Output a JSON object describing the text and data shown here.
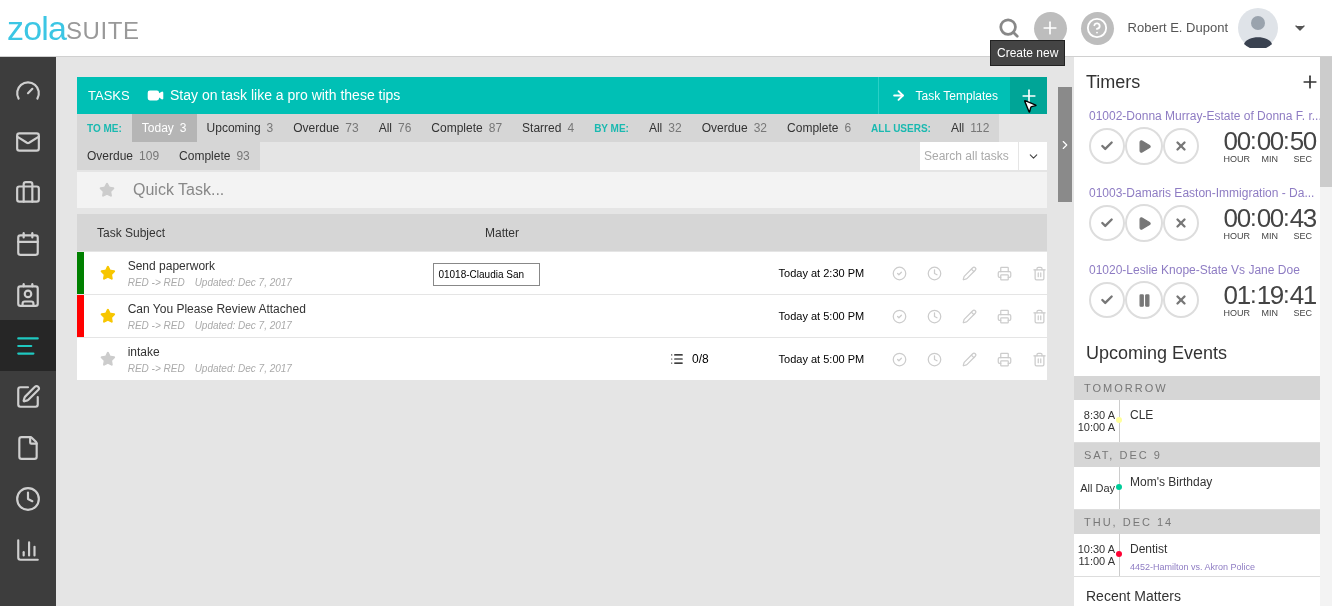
{
  "header": {
    "logo_primary": "zola",
    "logo_secondary": "SUITE",
    "user_name": "Robert E. Dupont",
    "tooltip": "Create new"
  },
  "sidebar": [
    {
      "kind": "dashboard",
      "selected": false
    },
    {
      "kind": "mail",
      "selected": false
    },
    {
      "kind": "briefcase",
      "selected": false
    },
    {
      "kind": "calendar",
      "selected": false
    },
    {
      "kind": "contacts",
      "selected": false
    },
    {
      "kind": "tasks",
      "selected": true
    },
    {
      "kind": "notes",
      "selected": false
    },
    {
      "kind": "document",
      "selected": false
    },
    {
      "kind": "clock",
      "selected": false
    },
    {
      "kind": "chart",
      "selected": false
    }
  ],
  "tasks_bar": {
    "title": "TASKS",
    "tip": "Stay on task like a pro with these tips",
    "templates": "Task Templates"
  },
  "filters": [
    {
      "label": "TO ME:",
      "items": [
        {
          "label": "Today",
          "count": "3",
          "selected": true
        },
        {
          "label": "Upcoming",
          "count": "3",
          "selected": false
        },
        {
          "label": "Overdue",
          "count": "73",
          "selected": false
        },
        {
          "label": "All",
          "count": "76",
          "selected": false
        },
        {
          "label": "Complete",
          "count": "87",
          "selected": false
        },
        {
          "label": "Starred",
          "count": "4",
          "selected": false
        }
      ]
    },
    {
      "label": "BY ME:",
      "items": [
        {
          "label": "All",
          "count": "32",
          "selected": false
        },
        {
          "label": "Overdue",
          "count": "32",
          "selected": false
        },
        {
          "label": "Complete",
          "count": "6",
          "selected": false
        }
      ]
    },
    {
      "label": "ALL USERS:",
      "items": [
        {
          "label": "All",
          "count": "112",
          "selected": false
        },
        {
          "label": "Overdue",
          "count": "109",
          "selected": false
        },
        {
          "label": "Complete",
          "count": "93",
          "selected": false
        }
      ]
    }
  ],
  "search": {
    "placeholder": "Search all tasks"
  },
  "quick_task": {
    "placeholder": "Quick Task..."
  },
  "table": {
    "columns": [
      "Task Subject",
      "Matter"
    ],
    "rows": [
      {
        "color": "#008000",
        "starred": true,
        "subject": "Send paperwork",
        "status": "RED -> RED",
        "updated": "Updated: Dec 7, 2017",
        "matter": "01018-Claudia San",
        "due": "Today at 2:30 PM"
      },
      {
        "color": "#ff0000",
        "starred": true,
        "subject": "Can You Please Review Attached",
        "status": "RED -> RED",
        "updated": "Updated: Dec 7, 2017",
        "due": "Today at 5:00 PM"
      },
      {
        "starred": false,
        "subject": "intake",
        "status": "RED -> RED",
        "updated": "Updated: Dec 7, 2017",
        "checklist": "0/8",
        "due": "Today at 5:00 PM"
      }
    ]
  },
  "timers": {
    "title": "Timers",
    "items": [
      {
        "matter": "01002-Donna Murray-Estate of Donna F. r...",
        "running": false,
        "hours": "00",
        "minutes": "00",
        "seconds": "50",
        "separators": [
          ":",
          ":"
        ],
        "units": [
          "HOUR",
          "MIN",
          "SEC"
        ]
      },
      {
        "matter": "01003-Damaris Easton-Immigration - Da...",
        "running": false,
        "hours": "00",
        "minutes": "00",
        "seconds": "43",
        "separators": [
          ":",
          ":"
        ],
        "units": [
          "HOUR",
          "MIN",
          "SEC"
        ]
      },
      {
        "matter": "01020-Leslie Knope-State Vs Jane Doe",
        "running": true,
        "hours": "01",
        "minutes": "19",
        "seconds": "41",
        "separators": [
          ":",
          ":"
        ],
        "units": [
          "HOUR",
          "MIN",
          "SEC"
        ]
      }
    ]
  },
  "events": {
    "title": "Upcoming Events",
    "days": [
      {
        "date": "TOMORROW",
        "items": [
          {
            "times": [
              "8:30 A",
              "10:00 A"
            ],
            "title": "CLE",
            "color": "#ffff99"
          }
        ]
      },
      {
        "date": "SAT, DEC 9",
        "items": [
          {
            "times": [
              "All Day"
            ],
            "title": "Mom's Birthday",
            "color": "#00cc99"
          }
        ]
      },
      {
        "date": "THU, DEC 14",
        "items": [
          {
            "times": [
              "10:30 A",
              "11:00 A"
            ],
            "title": "Dentist",
            "link": "4452-Hamilton vs. Akron Police",
            "color": "#ff0033"
          }
        ]
      }
    ]
  },
  "recent_matters": {
    "title": "Recent Matters"
  }
}
